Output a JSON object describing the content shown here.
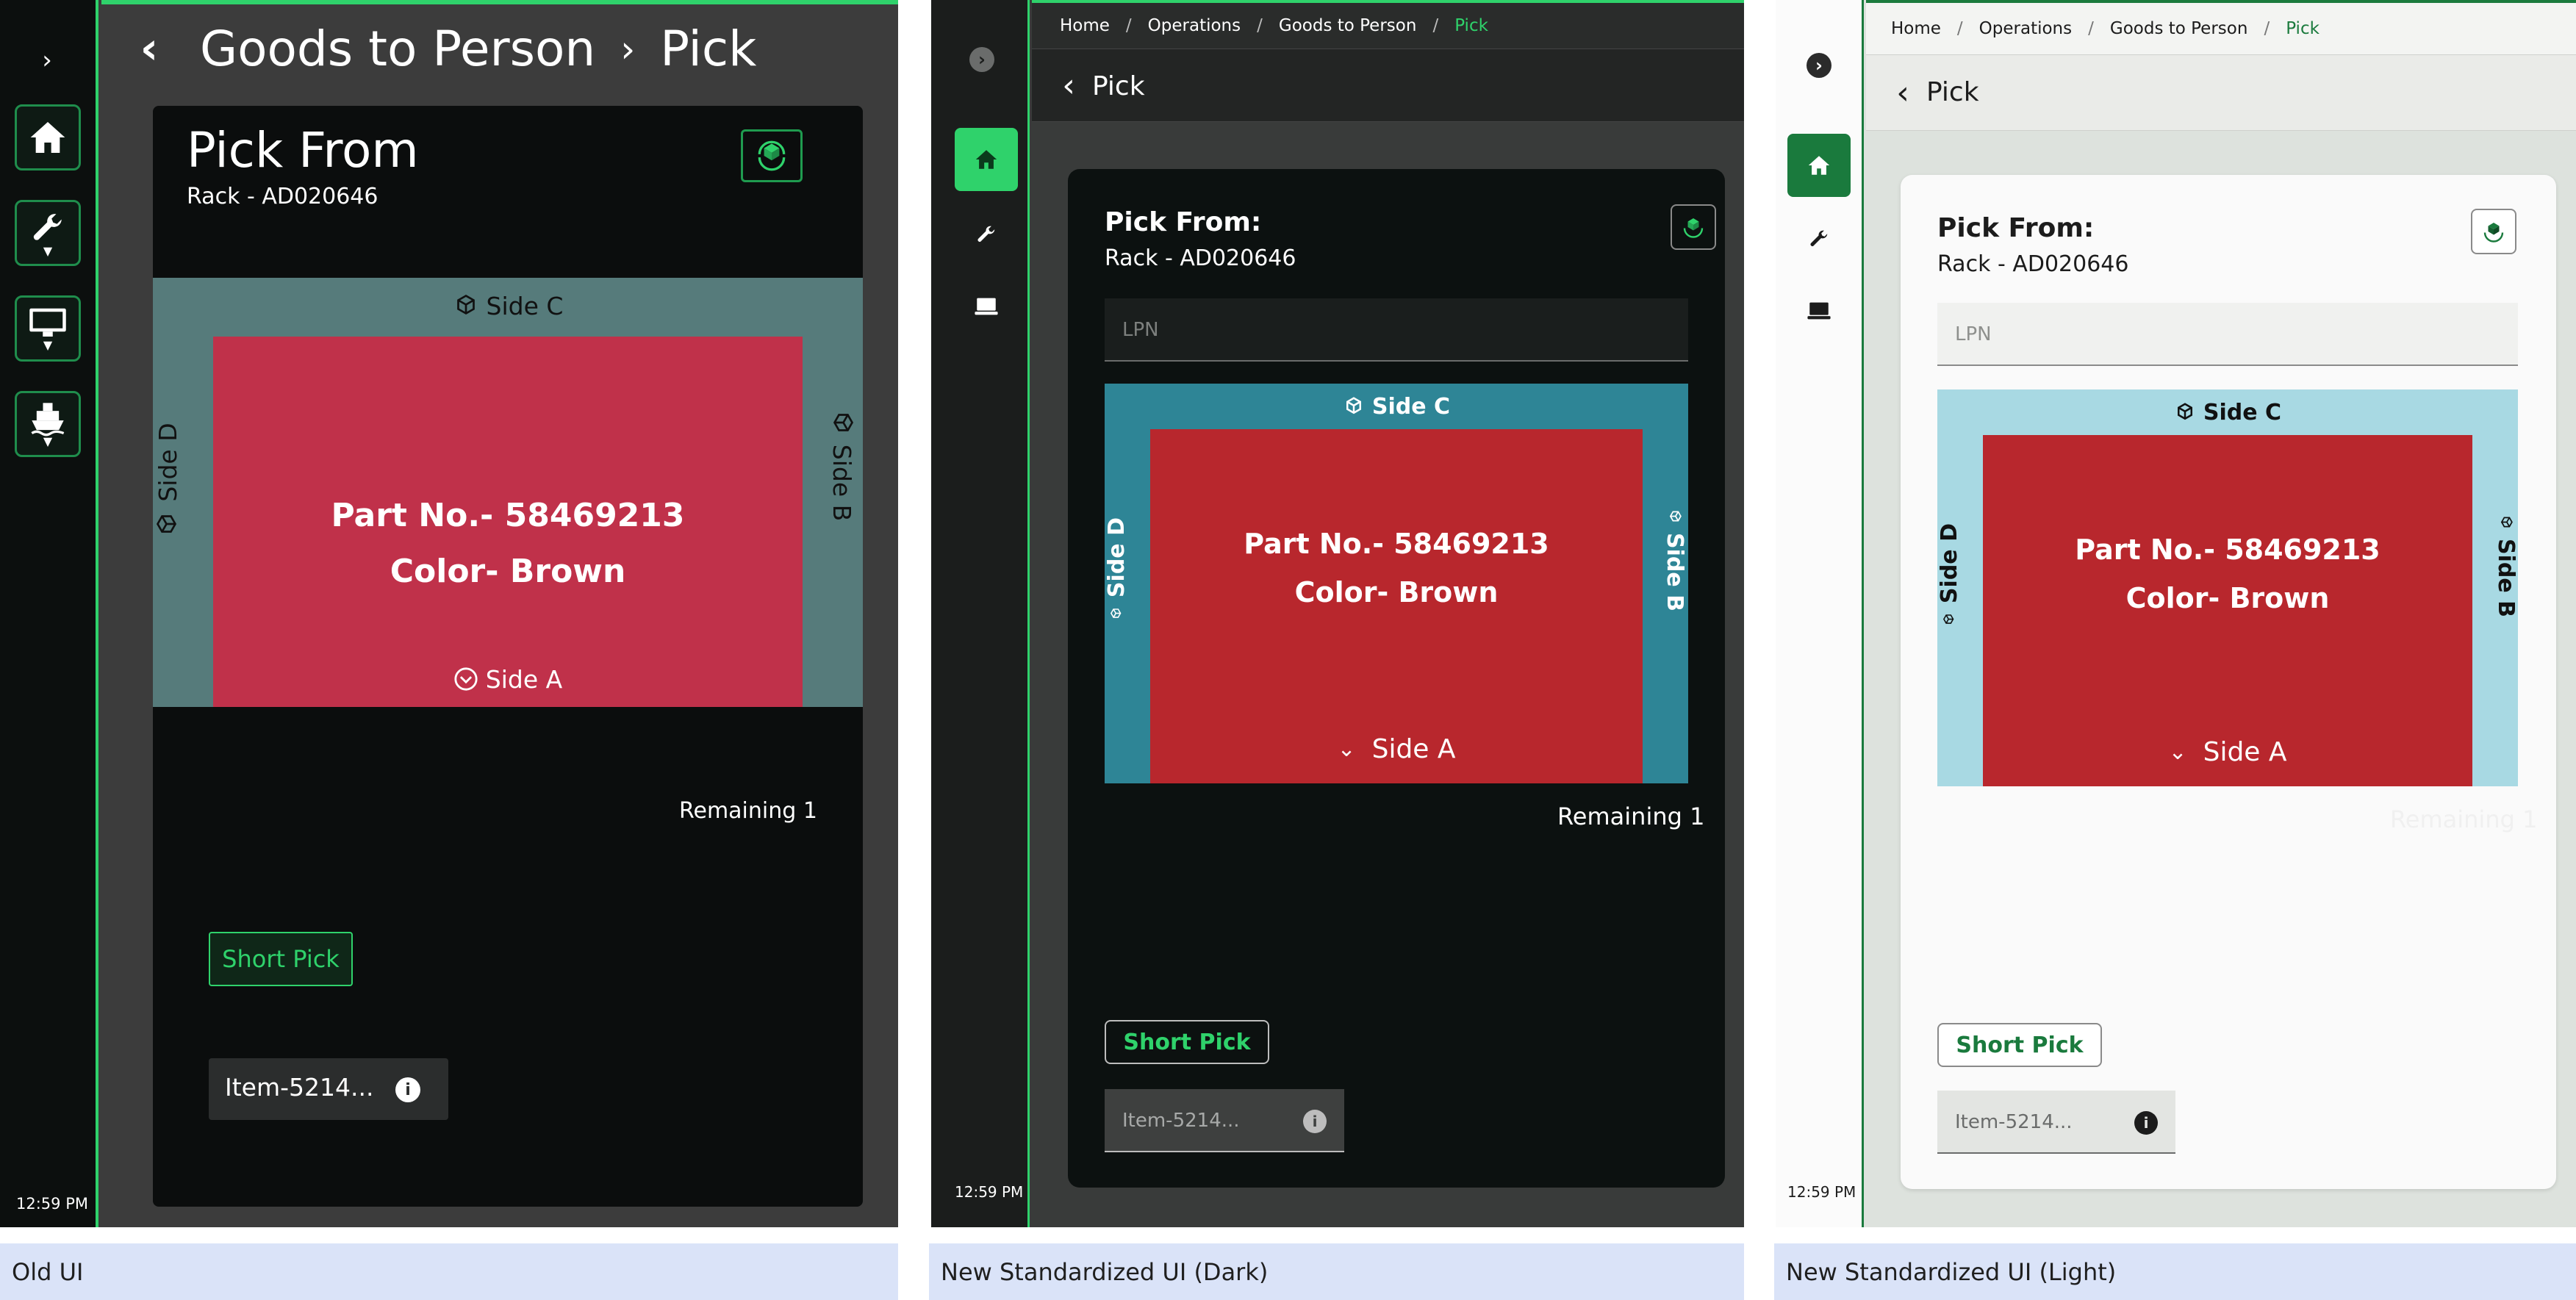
{
  "old": {
    "title": "Goods to Person",
    "title_sep": "›",
    "title_current": "Pick",
    "card_title": "Pick From",
    "rack": "Rack - AD020646",
    "side_c": "Side C",
    "side_d": "Side D",
    "side_b": "Side B",
    "side_a": "Side A",
    "part_no": "Part No.- 58469213",
    "color": "Color- Brown",
    "remaining": "Remaining 1",
    "short_pick": "Short Pick",
    "item": "Item-5214...",
    "time": "12:59 PM",
    "nav_icons": [
      "home-icon",
      "wrench-icon",
      "monitor-icon",
      "ship-icon"
    ]
  },
  "dark": {
    "breadcrumb": [
      "Home",
      "Operations",
      "Goods to Person",
      "Pick"
    ],
    "page_title": "Pick",
    "card_title": "Pick From:",
    "rack": "Rack - AD020646",
    "lpn_placeholder": "LPN",
    "side_c": "Side C",
    "side_d": "Side D",
    "side_b": "Side B",
    "side_a": "Side A",
    "part_no": "Part No.- 58469213",
    "color": "Color- Brown",
    "remaining": "Remaining 1",
    "short_pick": "Short Pick",
    "item": "Item-5214...",
    "time": "12:59 PM"
  },
  "light": {
    "breadcrumb": [
      "Home",
      "Operations",
      "Goods to Person",
      "Pick"
    ],
    "page_title": "Pick",
    "card_title": "Pick From:",
    "rack": "Rack - AD020646",
    "lpn_placeholder": "LPN",
    "side_c": "Side C",
    "side_d": "Side D",
    "side_b": "Side B",
    "side_a": "Side A",
    "part_no": "Part No.- 58469213",
    "color": "Color- Brown",
    "remaining": "Remaining 1",
    "short_pick": "Short Pick",
    "item": "Item-5214...",
    "time": "12:59 PM"
  },
  "captions": {
    "old": "Old UI",
    "dark": "New Standardized UI (Dark)",
    "light": "New Standardized UI (Light)"
  },
  "colors": {
    "accent_green": "#2fd26b",
    "brand_green": "#1a7a3d",
    "old_bin": "#c0314a",
    "new_bin": "#b8272d",
    "old_frame": "#567b7b",
    "dark_frame": "#2e8596",
    "light_frame": "#a8d9e3"
  }
}
